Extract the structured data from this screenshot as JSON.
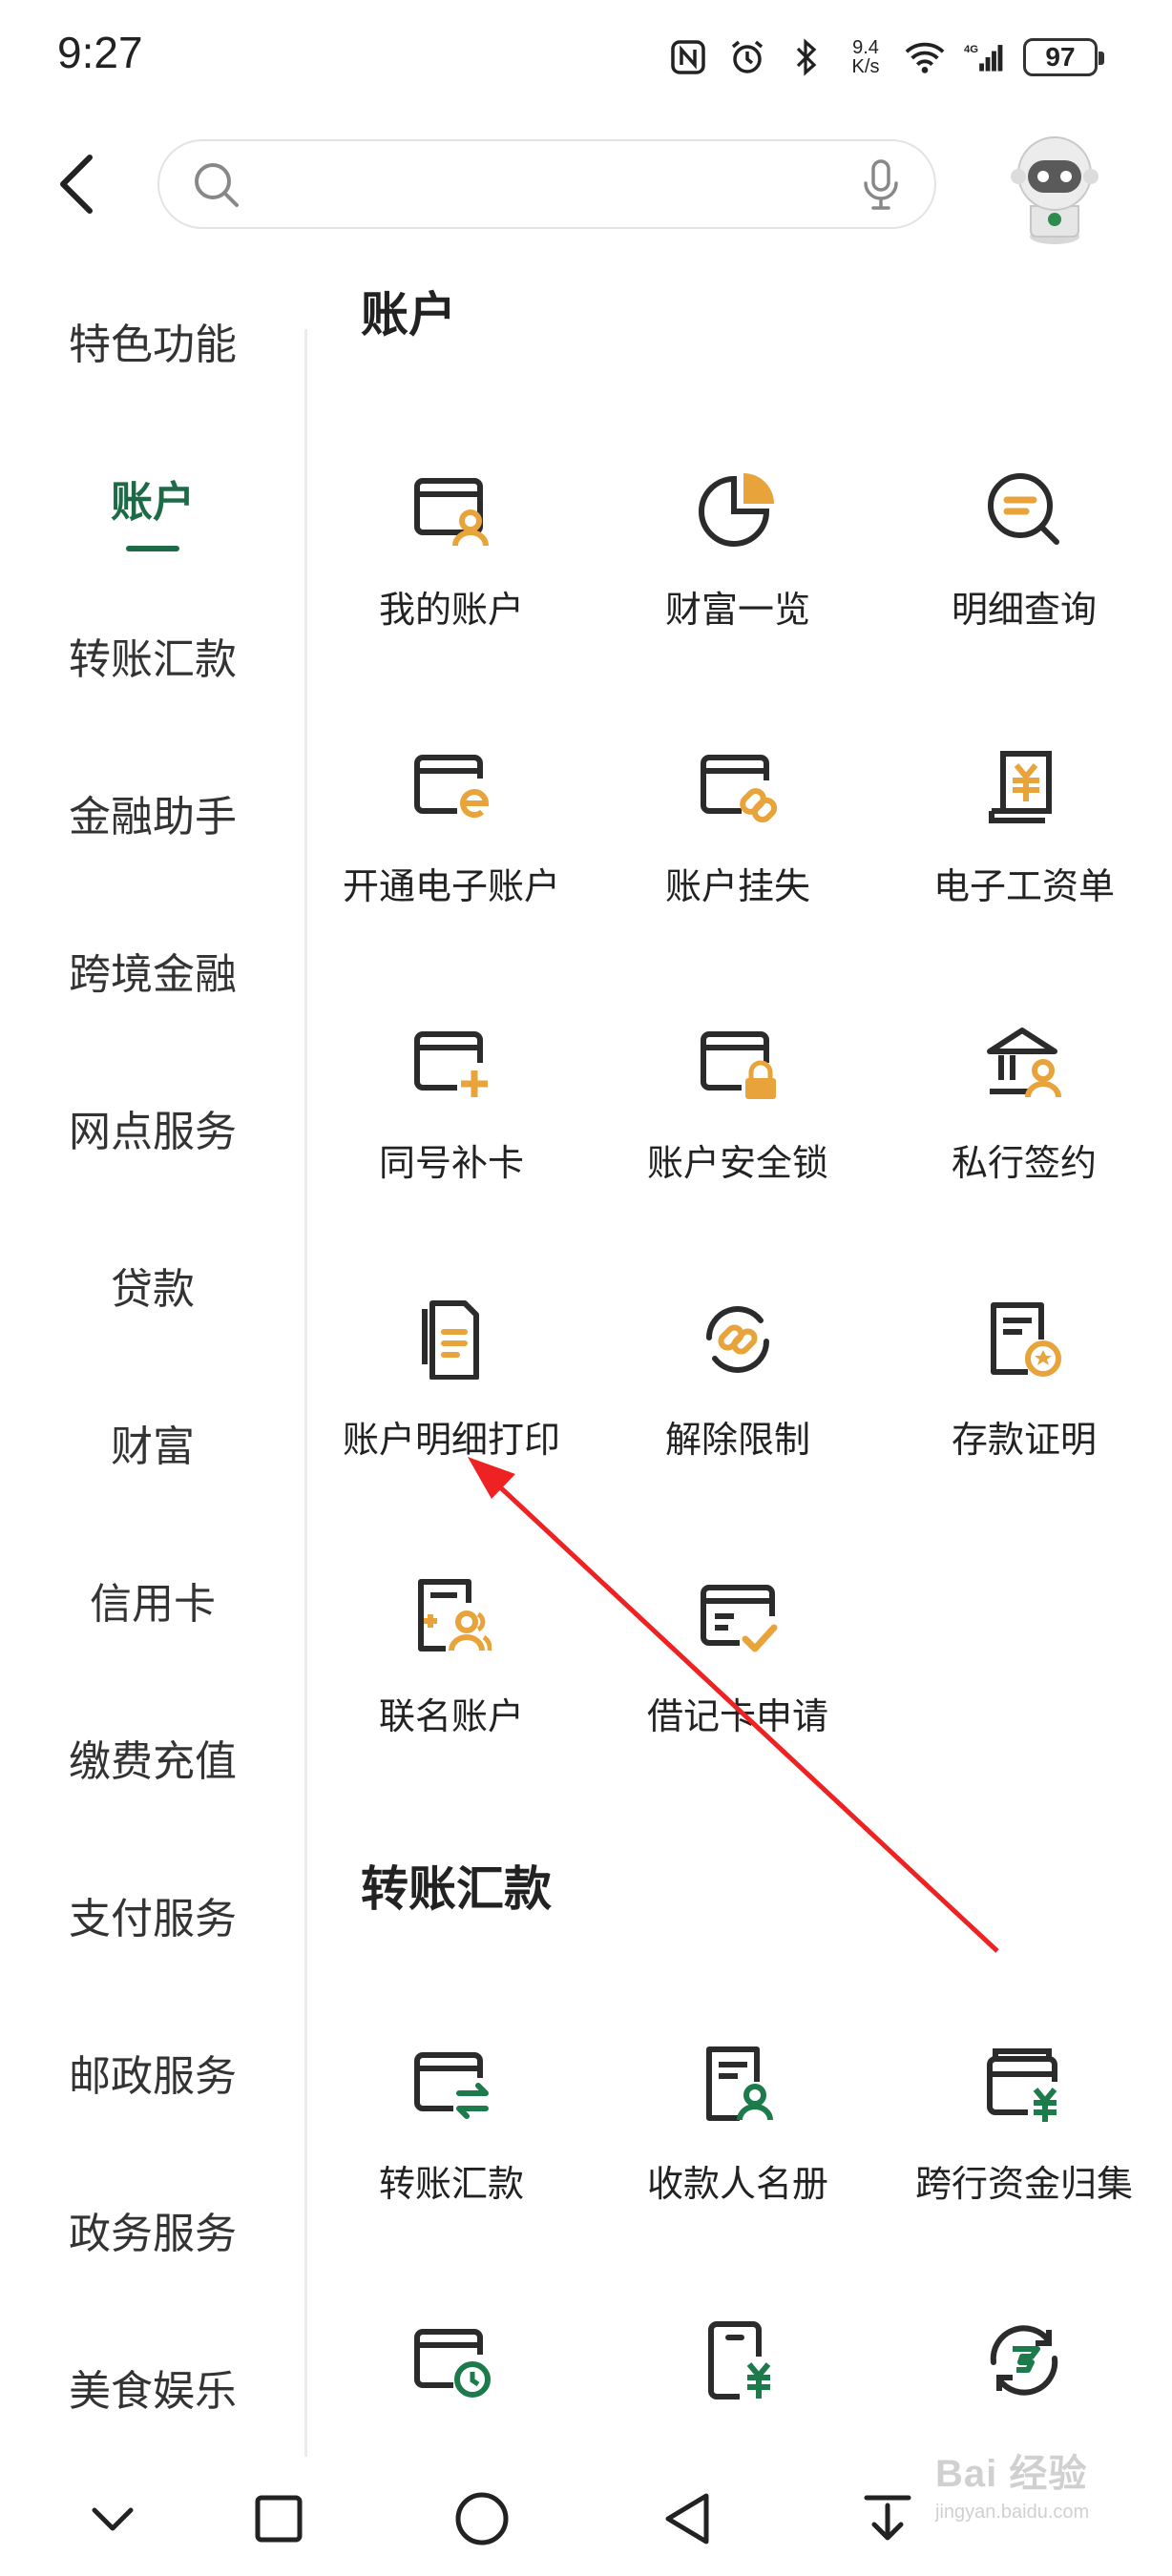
{
  "status_bar": {
    "time": "9:27",
    "speed_value": "9.4",
    "speed_unit": "K/s",
    "network": "4G",
    "battery": "97",
    "icons": [
      "nfc-icon",
      "alarm-icon",
      "bluetooth-icon",
      "wifi-icon",
      "signal-icon",
      "battery-icon"
    ]
  },
  "header": {
    "search_placeholder": "",
    "icons": [
      "back-icon",
      "search-icon",
      "microphone-icon",
      "avatar"
    ]
  },
  "sidebar": {
    "items": [
      {
        "label": "特色功能",
        "active": false
      },
      {
        "label": "账户",
        "active": true
      },
      {
        "label": "转账汇款",
        "active": false
      },
      {
        "label": "金融助手",
        "active": false
      },
      {
        "label": "跨境金融",
        "active": false
      },
      {
        "label": "网点服务",
        "active": false
      },
      {
        "label": "贷款",
        "active": false
      },
      {
        "label": "财富",
        "active": false
      },
      {
        "label": "信用卡",
        "active": false
      },
      {
        "label": "缴费充值",
        "active": false
      },
      {
        "label": "支付服务",
        "active": false
      },
      {
        "label": "邮政服务",
        "active": false
      },
      {
        "label": "政务服务",
        "active": false
      },
      {
        "label": "美食娱乐",
        "active": false
      }
    ]
  },
  "sections": {
    "account": {
      "title": "账户",
      "items": [
        {
          "label": "我的账户",
          "icon": "card-user-icon"
        },
        {
          "label": "财富一览",
          "icon": "pie-chart-icon"
        },
        {
          "label": "明细查询",
          "icon": "search-detail-icon"
        },
        {
          "label": "开通电子账户",
          "icon": "card-e-icon"
        },
        {
          "label": "账户挂失",
          "icon": "card-link-icon"
        },
        {
          "label": "电子工资单",
          "icon": "payslip-icon"
        },
        {
          "label": "同号补卡",
          "icon": "card-plus-icon"
        },
        {
          "label": "账户安全锁",
          "icon": "card-lock-icon"
        },
        {
          "label": "私行签约",
          "icon": "bank-user-icon"
        },
        {
          "label": "账户明细打印",
          "icon": "print-docs-icon"
        },
        {
          "label": "解除限制",
          "icon": "unlink-icon"
        },
        {
          "label": "存款证明",
          "icon": "certificate-icon"
        },
        {
          "label": "联名账户",
          "icon": "joint-account-icon"
        },
        {
          "label": "借记卡申请",
          "icon": "card-check-icon"
        }
      ]
    },
    "transfer": {
      "title": "转账汇款",
      "items": [
        {
          "label": "转账汇款",
          "icon": "card-transfer-icon"
        },
        {
          "label": "收款人名册",
          "icon": "payee-list-icon"
        },
        {
          "label": "跨行资金归集",
          "icon": "fund-collect-icon"
        },
        {
          "label": "",
          "icon": "card-clock-icon"
        },
        {
          "label": "",
          "icon": "phone-yuan-icon"
        },
        {
          "label": "",
          "icon": "postal-cycle-icon"
        }
      ]
    }
  },
  "bottom_nav": [
    "collapse-icon",
    "recents-icon",
    "home-icon",
    "back-triangle-icon",
    "download-icon"
  ],
  "watermark": {
    "line1": "Bai 经验",
    "line2": "jingyan.baidu.com"
  },
  "colors": {
    "accent": "#1d6b46",
    "icon_dark": "#2b2b2b",
    "icon_orange": "#e8a43a",
    "arrow": "#ee2222"
  }
}
